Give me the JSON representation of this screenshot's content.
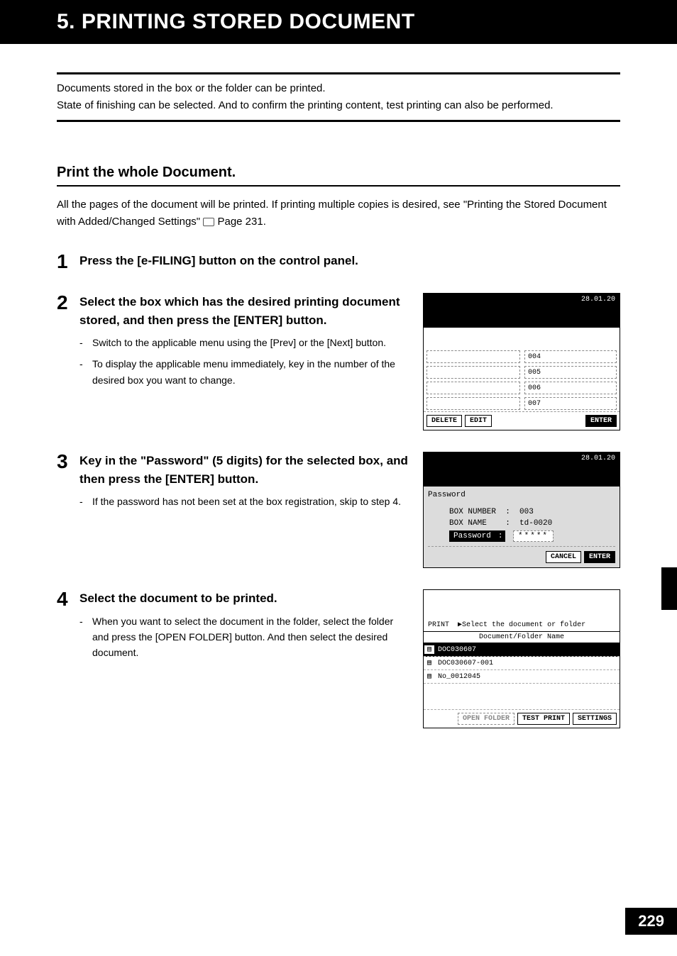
{
  "title": "5. PRINTING STORED DOCUMENT",
  "intro_line1": "Documents stored in the box or the folder can be printed.",
  "intro_line2": "State of finishing can be selected. And to confirm the printing content, test printing can also be performed.",
  "section": {
    "heading": "Print the whole Document.",
    "desc_prefix": "All the pages of the document will be printed. If printing multiple copies is desired, see \"Printing the Stored Document with Added/Changed Settings\" ",
    "desc_suffix": " Page 231."
  },
  "steps": {
    "s1": {
      "num": "1",
      "title": "Press the [e-FILING] button on the control panel."
    },
    "s2": {
      "num": "2",
      "title": "Select the box which has the desired printing document stored, and then press the [ENTER] button.",
      "sub1": "Switch to the applicable menu using the [Prev] or the [Next] button.",
      "sub2": "To display the applicable menu immediately, key in the number of the desired box you want to change."
    },
    "s3": {
      "num": "3",
      "title": "Key in the \"Password\" (5 digits) for the selected box, and then press the [ENTER] button.",
      "sub1": "If the password has not been set at the box registration, skip to step 4."
    },
    "s4": {
      "num": "4",
      "title": "Select the document to be printed.",
      "sub1": "When you want to select the document in the folder, select the folder and press the [OPEN FOLDER] button. And then select the desired document."
    }
  },
  "panel1": {
    "date": "28.01.20",
    "rows": [
      "004",
      "005",
      "006",
      "007"
    ],
    "btn_delete": "DELETE",
    "btn_edit": "EDIT",
    "btn_enter": "ENTER"
  },
  "panel2": {
    "date": "28.01.20",
    "pw_label": "Password",
    "box_number_label": "BOX NUMBER",
    "box_number_value": "003",
    "box_name_label": "BOX NAME",
    "box_name_value": "td-0020",
    "pw_field_label": "Password",
    "pw_value": "*****",
    "btn_cancel": "CANCEL",
    "btn_enter": "ENTER"
  },
  "panel3": {
    "header_left": "PRINT",
    "header_right": "Select the document or folder",
    "col_header": "Document/Folder Name",
    "rows": [
      "DOC030607",
      "DOC030607-001",
      "No_0012045"
    ],
    "btn_open": "OPEN FOLDER",
    "btn_test": "TEST PRINT",
    "btn_settings": "SETTINGS"
  },
  "page_number": "229"
}
